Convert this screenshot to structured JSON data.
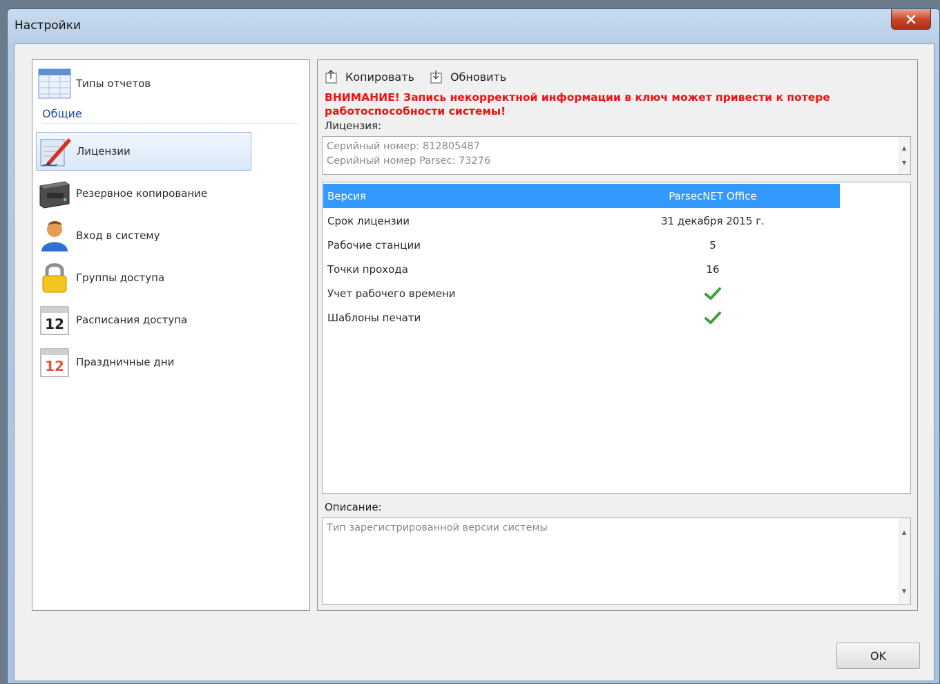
{
  "window": {
    "title": "Настройки"
  },
  "sidebar": {
    "items": [
      {
        "label": "Типы отчетов",
        "icon": "report-types-icon"
      },
      {
        "label": "Лицензии",
        "icon": "license-pen-icon"
      },
      {
        "label": "Резервное копирование",
        "icon": "backup-device-icon"
      },
      {
        "label": "Вход в систему",
        "icon": "user-login-icon"
      },
      {
        "label": "Группы доступа",
        "icon": "padlock-icon"
      },
      {
        "label": "Расписания доступа",
        "icon": "calendar-icon"
      },
      {
        "label": "Праздничные дни",
        "icon": "holiday-calendar-icon"
      }
    ],
    "group_header": "Общие",
    "selected_index": 1
  },
  "toolbar": {
    "copy_label": "Копировать",
    "refresh_label": "Обновить"
  },
  "warning": "ВНИМАНИЕ! Запись некорректной информации в ключ может привести к потере работоспособности системы!",
  "license": {
    "label": "Лицензия:",
    "lines": [
      "Серийный номер: 812805487",
      "Серийный номер Parsec: 73276"
    ]
  },
  "grid": {
    "rows": [
      {
        "name": "Версия",
        "value": "ParsecNET Office",
        "selected": true
      },
      {
        "name": "Срок лицензии",
        "value": "31 декабря 2015 г."
      },
      {
        "name": "Рабочие станции",
        "value": "5"
      },
      {
        "name": "Точки прохода",
        "value": "16"
      },
      {
        "name": "Учет рабочего времени",
        "value": "",
        "check": true
      },
      {
        "name": "Шаблоны печати",
        "value": "",
        "check": true
      }
    ]
  },
  "description": {
    "label": "Описание:",
    "text": "Тип зарегистрированной версии системы"
  },
  "buttons": {
    "ok": "OK"
  },
  "colors": {
    "selection": "#3399ff",
    "warning": "#ee1111",
    "check": "#3ca23c"
  }
}
